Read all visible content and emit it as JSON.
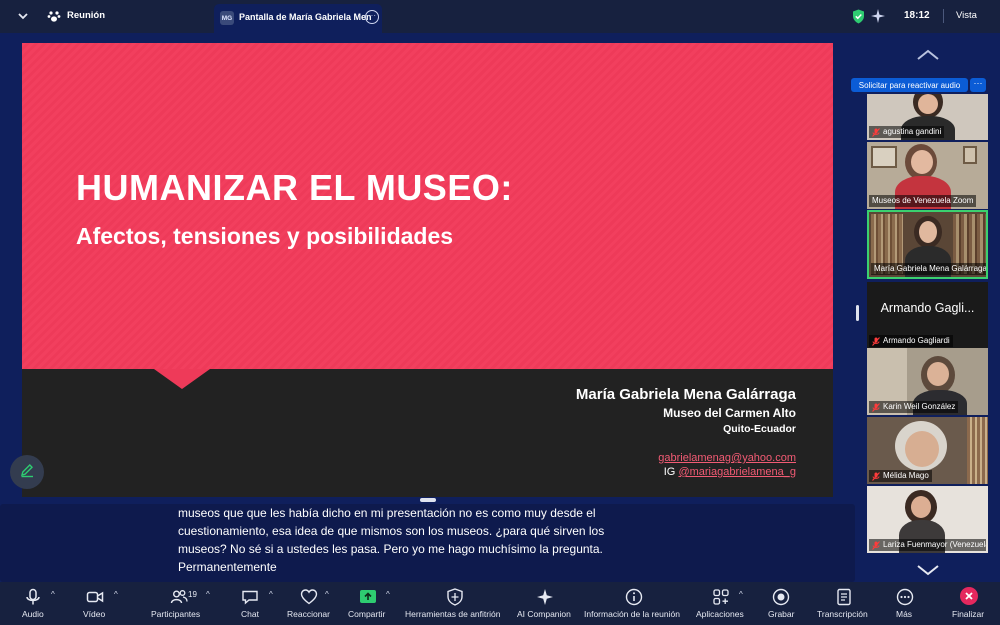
{
  "topbar": {
    "meeting_label": "Reunión",
    "share_tab_badge": "MG",
    "share_tab_title": "Pantalla de María Gabriela Mena Galárraga",
    "time": "18:12",
    "view_label": "Vista"
  },
  "slide": {
    "title": "HUMANIZAR EL MUSEO:",
    "subtitle": "Afectos, tensiones y posibilidades",
    "author": "María Gabriela Mena Galárraga",
    "institution": "Museo del Carmen Alto",
    "location": "Quito-Ecuador",
    "email": "gabrielamenag@yahoo.com",
    "ig_prefix": "IG",
    "ig_handle": "@mariagabrielamena_g",
    "colors": {
      "top": "#F03E5C",
      "bottom": "#222222",
      "link": "#F25B74"
    }
  },
  "captions": {
    "lines": [
      "museos que que les había dicho en mi presentación no es como muy desde el",
      "cuestionamiento, esa idea de que mismos son los museos. ¿para qué sirven los",
      "museos? No sé si a ustedes les pasa. Pero yo me hago muchísimo la pregunta.",
      "Permanentemente"
    ]
  },
  "panel": {
    "audio_request_label": "Solicitar para reactivar audio",
    "audio_more_label": "···",
    "participants": [
      {
        "name": "agustina gandini",
        "muted": true,
        "active": false
      },
      {
        "name": "Museos de Venezuela Zoom",
        "muted": false,
        "active": false
      },
      {
        "name": "María Gabriela Mena Galárraga",
        "muted": false,
        "active": true
      },
      {
        "name": "Armando Gagliardi",
        "display_name": "Armando Gagli...",
        "muted": true,
        "active": false
      },
      {
        "name": "Karin Weil González",
        "muted": true,
        "active": false
      },
      {
        "name": "Mélida Mago",
        "muted": true,
        "active": false
      },
      {
        "name": "Lariza Fuenmayor (Venezuela)",
        "muted": true,
        "active": false
      }
    ]
  },
  "toolbar": {
    "audio": "Audio",
    "video": "Vídeo",
    "participants": "Participantes",
    "participants_count": "19",
    "chat": "Chat",
    "react": "Reaccionar",
    "share": "Compartir",
    "host_tools": "Herramientas de anfitrión",
    "ai_companion": "AI Companion",
    "meeting_info": "Información de la reunión",
    "apps": "Aplicaciones",
    "record": "Grabar",
    "transcription": "Transcripción",
    "more": "Más",
    "end": "Finalizar",
    "colors": {
      "share": "#2ECC71",
      "end": "#E5285E"
    }
  }
}
